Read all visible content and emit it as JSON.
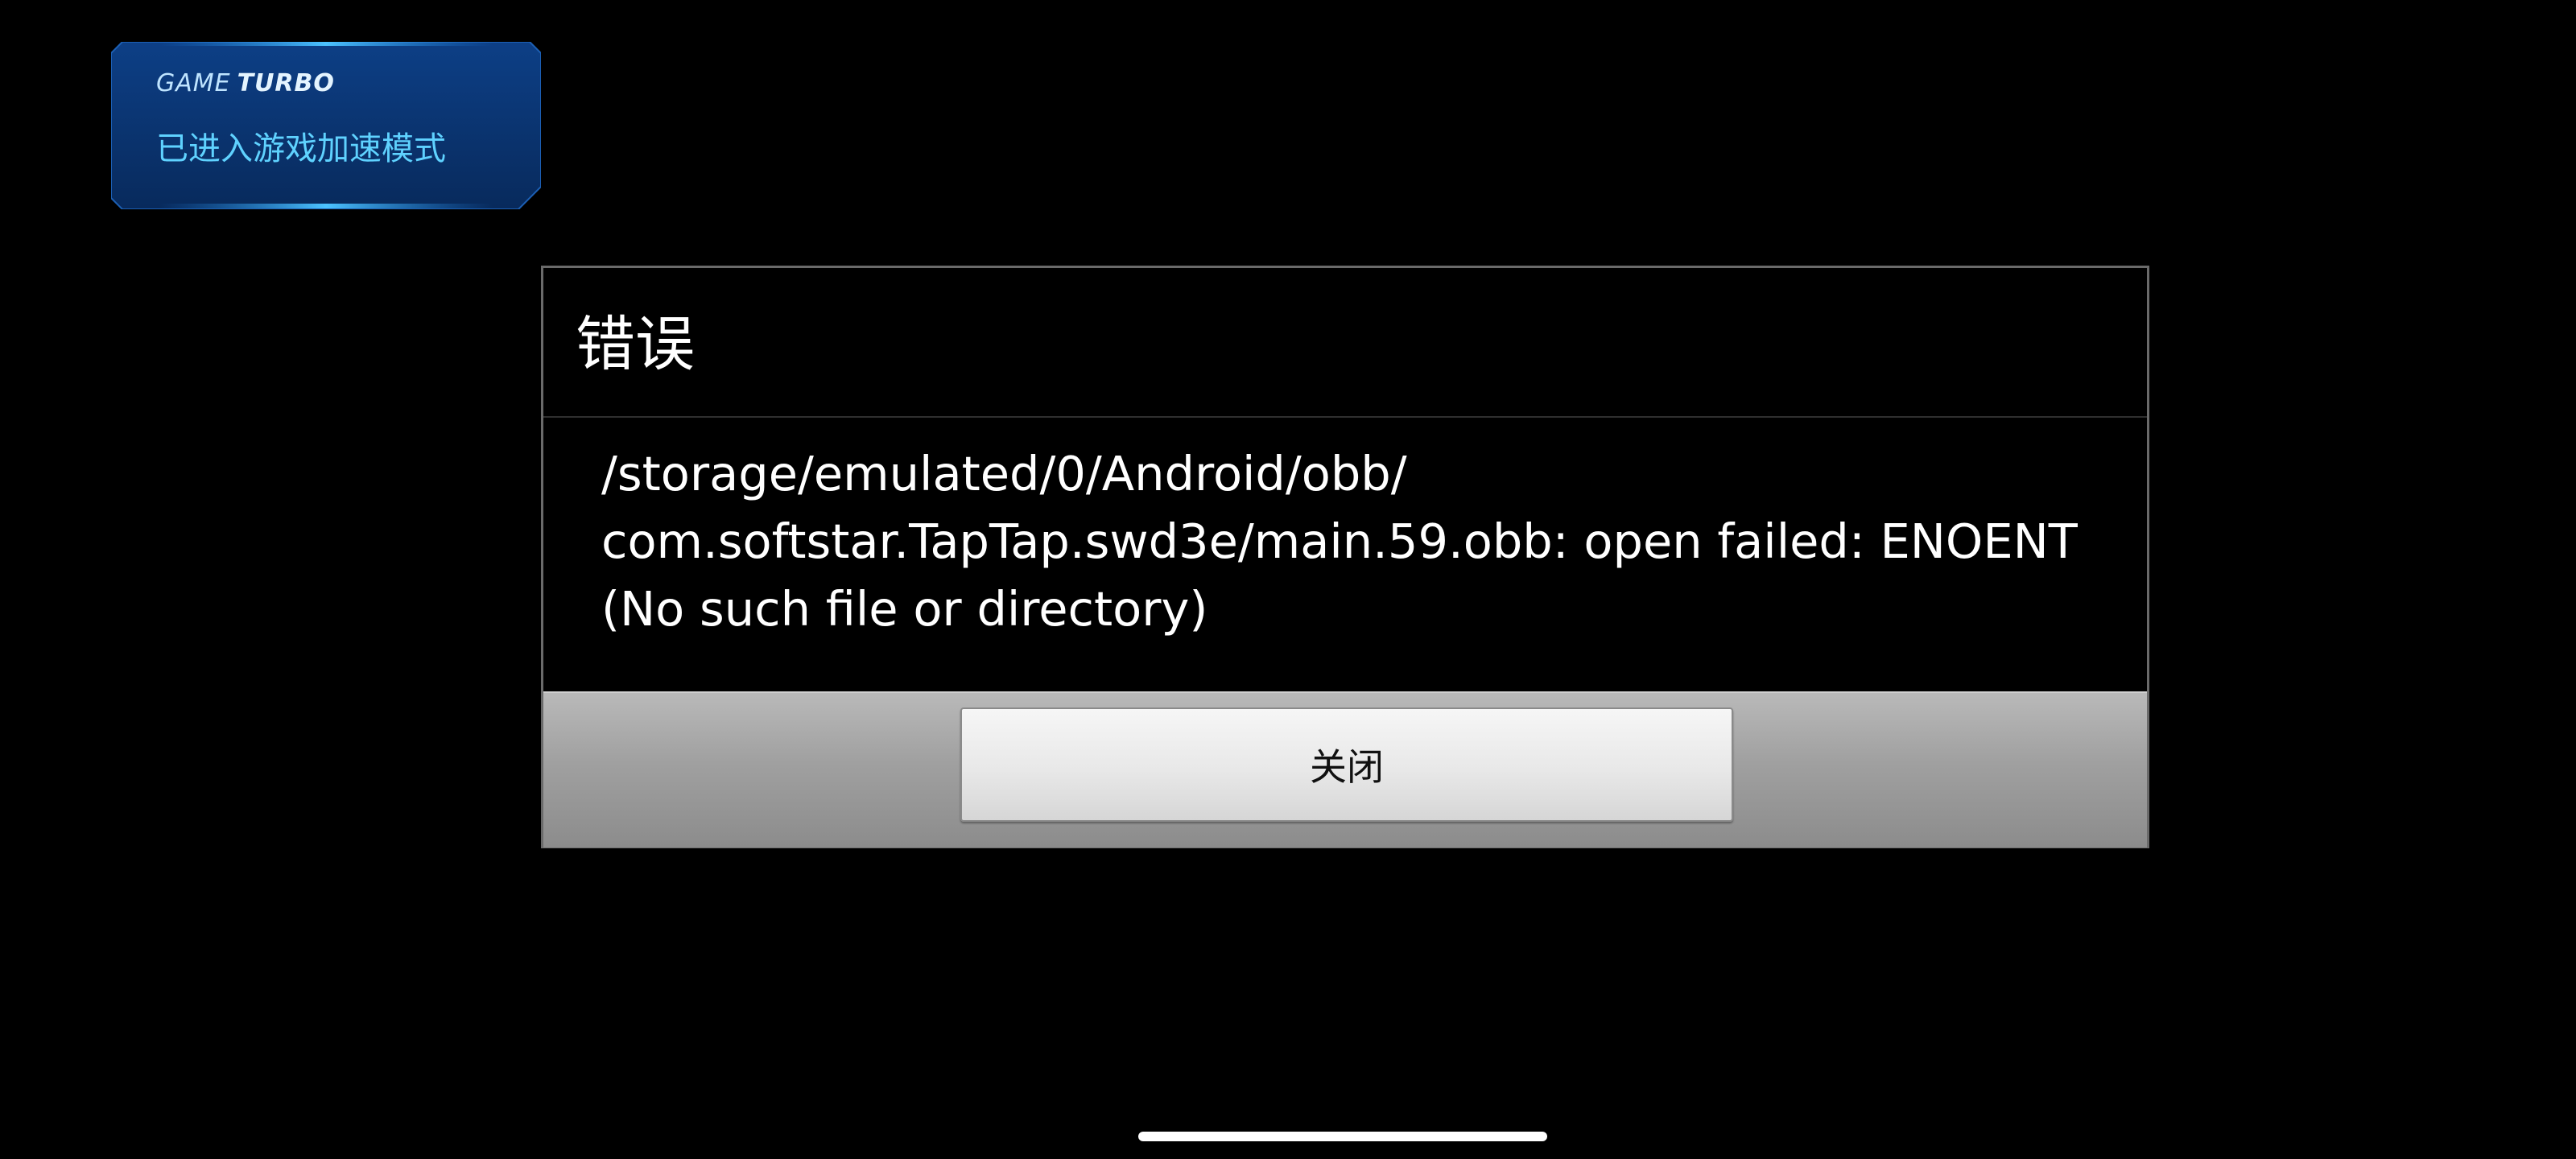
{
  "turbo_toast": {
    "brand_game": "GAME",
    "brand_turbo": "TURBO",
    "message": "已进入游戏加速模式"
  },
  "background_dialog": {
    "title": "错误"
  },
  "error_dialog": {
    "title": "错误",
    "message": "/storage/emulated/0/Android/obb/\ncom.softstar.TapTap.swd3e/main.59.obb: open failed: ENOENT\n(No such file or directory)",
    "close_label": "关闭"
  },
  "colors": {
    "background": "#000000",
    "toast_fill": "#0b3a7a",
    "toast_glow": "#27a9ff",
    "toast_text": "#5fd2ff",
    "dialog_border": "#6a6a6a",
    "button_bar": "#a0a0a0"
  }
}
